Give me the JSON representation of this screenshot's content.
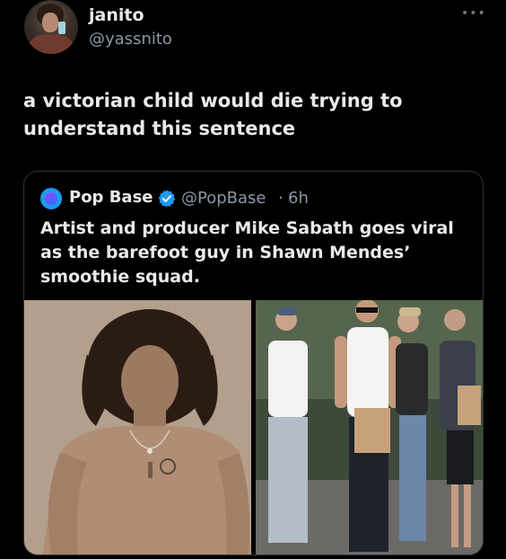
{
  "author": {
    "display_name": "janito",
    "handle": "@yassnito"
  },
  "tweet": {
    "text": "a victorian child would die trying to understand this sentence"
  },
  "quoted_tweet": {
    "author_name": "Pop Base",
    "verified": true,
    "handle": "@PopBase",
    "separator": "·",
    "time": "6h",
    "text": "Artist and producer Mike Sabath goes viral as the barefoot guy in Shawn Mendes’ smoothie squad."
  },
  "icons": {
    "more": "more-horizontal-icon",
    "verified": "verified-badge-icon"
  },
  "colors": {
    "background": "#000000",
    "primary_text": "#e7e9ea",
    "secondary_text": "#8b98a5",
    "verified": "#1d9bf0",
    "card_border": "#2f3336"
  }
}
